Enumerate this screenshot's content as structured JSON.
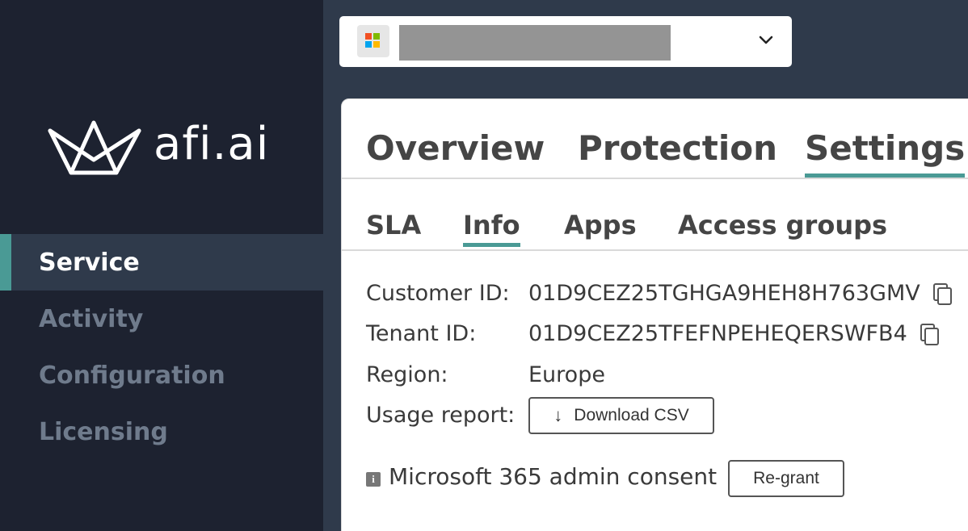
{
  "brand": {
    "name": "afi.ai"
  },
  "sidebar": {
    "items": [
      {
        "label": "Service",
        "active": true
      },
      {
        "label": "Activity",
        "active": false
      },
      {
        "label": "Configuration",
        "active": false
      },
      {
        "label": "Licensing",
        "active": false
      }
    ]
  },
  "topbar": {
    "tenant_icon": "microsoft-logo-icon",
    "tenant_name": "",
    "chevron_icon": "chevron-down-icon"
  },
  "tabs": [
    {
      "label": "Overview",
      "active": false
    },
    {
      "label": "Protection",
      "active": false
    },
    {
      "label": "Settings",
      "active": true
    }
  ],
  "subtabs": [
    {
      "label": "SLA",
      "active": false
    },
    {
      "label": "Info",
      "active": true
    },
    {
      "label": "Apps",
      "active": false
    },
    {
      "label": "Access groups",
      "active": false
    }
  ],
  "info": {
    "customer_id_label": "Customer ID:",
    "customer_id_value": "01D9CEZ25TGHGA9HEH8H763GMV",
    "tenant_id_label": "Tenant ID:",
    "tenant_id_value": "01D9CEZ25TFEFNPEHEQERSWFB4",
    "region_label": "Region:",
    "region_value": "Europe",
    "usage_label": "Usage report:",
    "download_button": "Download CSV",
    "consent_icon": "info-icon",
    "consent_text": "Microsoft 365 admin consent",
    "regrant_button": "Re-grant"
  },
  "colors": {
    "sidebar_bg": "#1d2230",
    "topbar_bg": "#2f3a4b",
    "accent": "#4a9a95",
    "ms_red": "#f25022",
    "ms_green": "#7fba00",
    "ms_blue": "#00a4ef",
    "ms_yellow": "#ffb900"
  }
}
